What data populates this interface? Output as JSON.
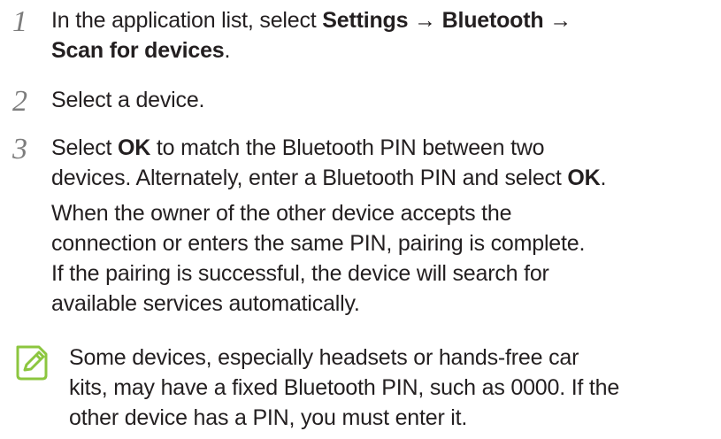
{
  "steps": [
    {
      "number": "1",
      "line1_prefix": "In the application list, select ",
      "line1_bold1": "Settings",
      "line1_arrow1": " → ",
      "line1_bold2": "Bluetooth",
      "line1_arrow2": " →",
      "line2_bold": "Scan for devices",
      "line2_suffix": "."
    },
    {
      "number": "2",
      "text": "Select a device."
    },
    {
      "number": "3",
      "line1_prefix": "Select ",
      "line1_bold": "OK",
      "line1_suffix": " to match the Bluetooth PIN between two",
      "line2_prefix": "devices. Alternately, enter a Bluetooth PIN and select ",
      "line2_bold": "OK",
      "line2_suffix": "."
    }
  ],
  "paragraph": {
    "lines": [
      "When the owner of the other device accepts the",
      "connection or enters the same PIN, pairing is complete.",
      "If the pairing is successful, the device will search for",
      "available services automatically."
    ]
  },
  "note": {
    "icon": "note-pencil-icon",
    "accent_color": "#8cc63f",
    "lines": [
      "Some devices, especially headsets or hands-free car",
      "kits, may have a fixed Bluetooth PIN, such as 0000. If the",
      "other device has a PIN, you must enter it."
    ]
  }
}
